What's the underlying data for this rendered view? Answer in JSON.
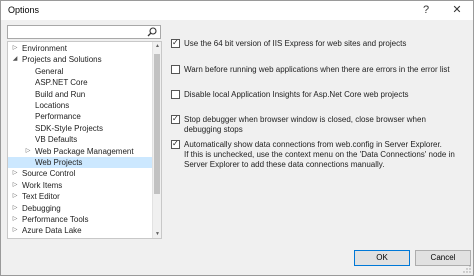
{
  "window": {
    "title": "Options",
    "help_glyph": "?",
    "close_glyph": "✕"
  },
  "search": {
    "value": "",
    "placeholder": ""
  },
  "tree": [
    {
      "label": "Environment",
      "arrow": "▷",
      "indent": 0
    },
    {
      "label": "Projects and Solutions",
      "arrow": "◢",
      "indent": 0
    },
    {
      "label": "General",
      "arrow": "",
      "indent": 1
    },
    {
      "label": "ASP.NET Core",
      "arrow": "",
      "indent": 1
    },
    {
      "label": "Build and Run",
      "arrow": "",
      "indent": 1
    },
    {
      "label": "Locations",
      "arrow": "",
      "indent": 1
    },
    {
      "label": "Performance",
      "arrow": "",
      "indent": 1
    },
    {
      "label": "SDK-Style Projects",
      "arrow": "",
      "indent": 1
    },
    {
      "label": "VB Defaults",
      "arrow": "",
      "indent": 1
    },
    {
      "label": "Web Package Management",
      "arrow": "▷",
      "indent": 1
    },
    {
      "label": "Web Projects",
      "arrow": "",
      "indent": 1,
      "selected": true
    },
    {
      "label": "Source Control",
      "arrow": "▷",
      "indent": 0
    },
    {
      "label": "Work Items",
      "arrow": "▷",
      "indent": 0
    },
    {
      "label": "Text Editor",
      "arrow": "▷",
      "indent": 0
    },
    {
      "label": "Debugging",
      "arrow": "▷",
      "indent": 0
    },
    {
      "label": "Performance Tools",
      "arrow": "▷",
      "indent": 0
    },
    {
      "label": "Azure Data Lake",
      "arrow": "▷",
      "indent": 0
    }
  ],
  "options": [
    {
      "checked": true,
      "lines": [
        "Use the 64 bit version of IIS Express for web sites and projects"
      ]
    },
    {
      "checked": false,
      "lines": [
        "Warn before running web applications when there are errors in the error list"
      ]
    },
    {
      "checked": false,
      "lines": [
        "Disable local Application Insights for Asp.Net Core web projects"
      ]
    },
    {
      "checked": true,
      "lines": [
        "Stop debugger when browser window is closed, close browser when",
        "debugging stops"
      ]
    },
    {
      "checked": true,
      "lines": [
        "Automatically show data connections from web.config in Server Explorer.",
        "If this is unchecked, use the context menu on the 'Data Connections' node in",
        "Server Explorer to add these data connections manually."
      ]
    }
  ],
  "buttons": {
    "ok": "OK",
    "cancel": "Cancel"
  }
}
